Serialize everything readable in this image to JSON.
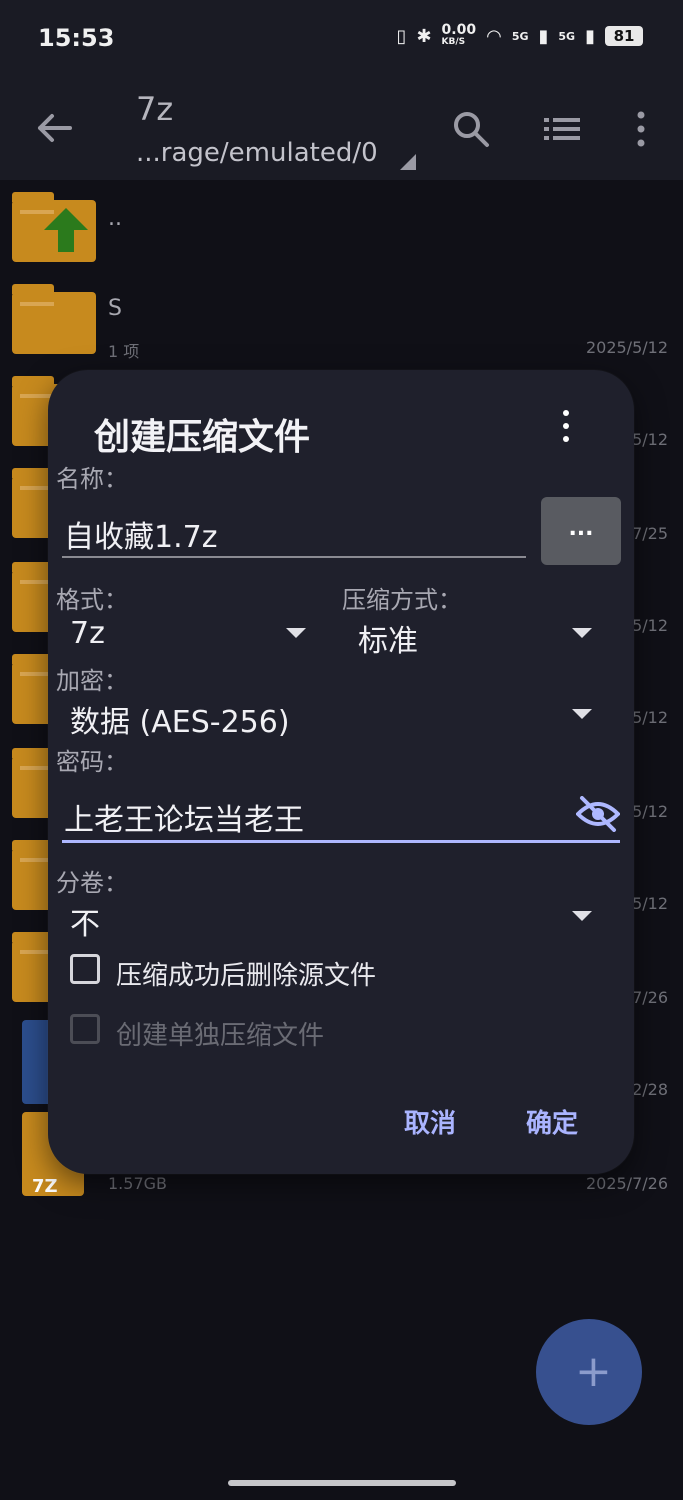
{
  "status_bar": {
    "time": "15:53",
    "net_speed": "0.00",
    "net_unit": "KB/S",
    "net_type_1": "5G",
    "net_type_2": "5G",
    "battery": "81"
  },
  "app_bar": {
    "title": "7z",
    "path": "...rage/emulated/0"
  },
  "file_list": [
    {
      "name": "..",
      "sub": "",
      "date": ""
    },
    {
      "name": "S",
      "sub": "1 项",
      "date": "2025/5/12"
    },
    {
      "name": "",
      "sub": "",
      "date": "5/12"
    },
    {
      "name": "",
      "sub": "",
      "date": "7/25"
    },
    {
      "name": "",
      "sub": "",
      "date": "5/12"
    },
    {
      "name": "",
      "sub": "",
      "date": "5/12"
    },
    {
      "name": "",
      "sub": "",
      "date": "5/12"
    },
    {
      "name": "",
      "sub": "",
      "date": "5/12"
    },
    {
      "name": "",
      "sub": "",
      "date": "7/26"
    },
    {
      "name": "",
      "sub": "",
      "date": "2/28"
    },
    {
      "name": "",
      "sub": "1.57GB",
      "date": "2025/7/26"
    }
  ],
  "zip_icon_label": "7Z",
  "dialog": {
    "title": "创建压缩文件",
    "name_label": "名称：",
    "name_value": "自收藏1.7z",
    "browse_label": "...",
    "format_label": "格式：",
    "format_value": "7z",
    "compression_label": "压缩方式：",
    "compression_value": "标准",
    "encryption_label": "加密：",
    "encryption_value": "数据 (AES-256)",
    "password_label": "密码：",
    "password_value": "上老王论坛当老王",
    "split_label": "分卷：",
    "split_value": "不",
    "checkbox_delete_label": "压缩成功后删除源文件",
    "checkbox_delete_checked": false,
    "checkbox_separate_label": "创建单独压缩文件",
    "checkbox_separate_checked": false,
    "checkbox_separate_enabled": false,
    "cancel_label": "取消",
    "ok_label": "确定"
  },
  "fab": {
    "label": "+"
  },
  "colors": {
    "accent": "#aab4ff",
    "dialog_bg": "#1f202c",
    "folder": "#c78a1e",
    "fab": "#37508f"
  }
}
